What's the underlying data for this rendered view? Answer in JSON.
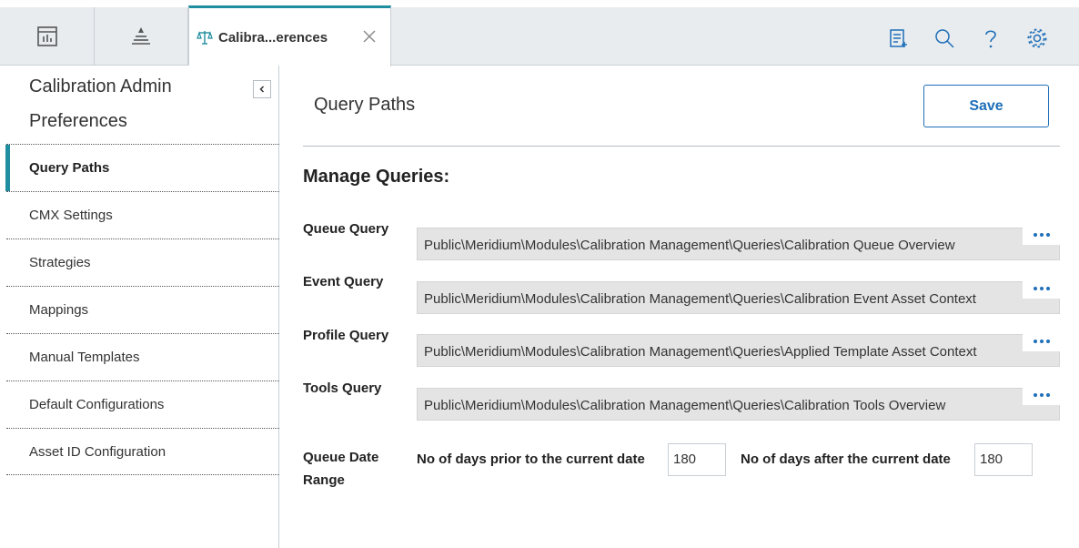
{
  "tabs": {
    "icon_tabs": [
      {
        "icon": "dashboard-icon"
      },
      {
        "icon": "asset-hierarchy-icon"
      }
    ],
    "active": {
      "label": "Calibra...erences",
      "icon": "scale-icon"
    }
  },
  "toolbar_icons": [
    "notes-icon",
    "search-icon",
    "help-icon",
    "settings-icon"
  ],
  "sidebar": {
    "title": "Calibration Admin Preferences",
    "items": [
      {
        "label": "Query Paths",
        "active": true
      },
      {
        "label": "CMX Settings"
      },
      {
        "label": "Strategies"
      },
      {
        "label": "Mappings"
      },
      {
        "label": "Manual Templates"
      },
      {
        "label": "Default Configurations"
      },
      {
        "label": "Asset ID Configuration"
      }
    ]
  },
  "main": {
    "title": "Query Paths",
    "save_label": "Save",
    "section_title": "Manage Queries:",
    "queries": [
      {
        "label": "Queue Query",
        "value": "Public\\Meridium\\Modules\\Calibration Management\\Queries\\Calibration Queue Overview"
      },
      {
        "label": "Event Query",
        "value": "Public\\Meridium\\Modules\\Calibration Management\\Queries\\Calibration Event Asset Context"
      },
      {
        "label": "Profile Query",
        "value": "Public\\Meridium\\Modules\\Calibration Management\\Queries\\Applied Template Asset Context"
      },
      {
        "label": "Tools Query",
        "value": "Public\\Meridium\\Modules\\Calibration Management\\Queries\\Calibration Tools Overview"
      }
    ],
    "date_range": {
      "label": "Queue Date Range",
      "prior_label": "No of days prior to the current date",
      "prior_value": "180",
      "after_label": "No of days after the current date",
      "after_value": "180"
    }
  },
  "colors": {
    "accent": "#1f8ea0",
    "button": "#1f6fb8"
  }
}
